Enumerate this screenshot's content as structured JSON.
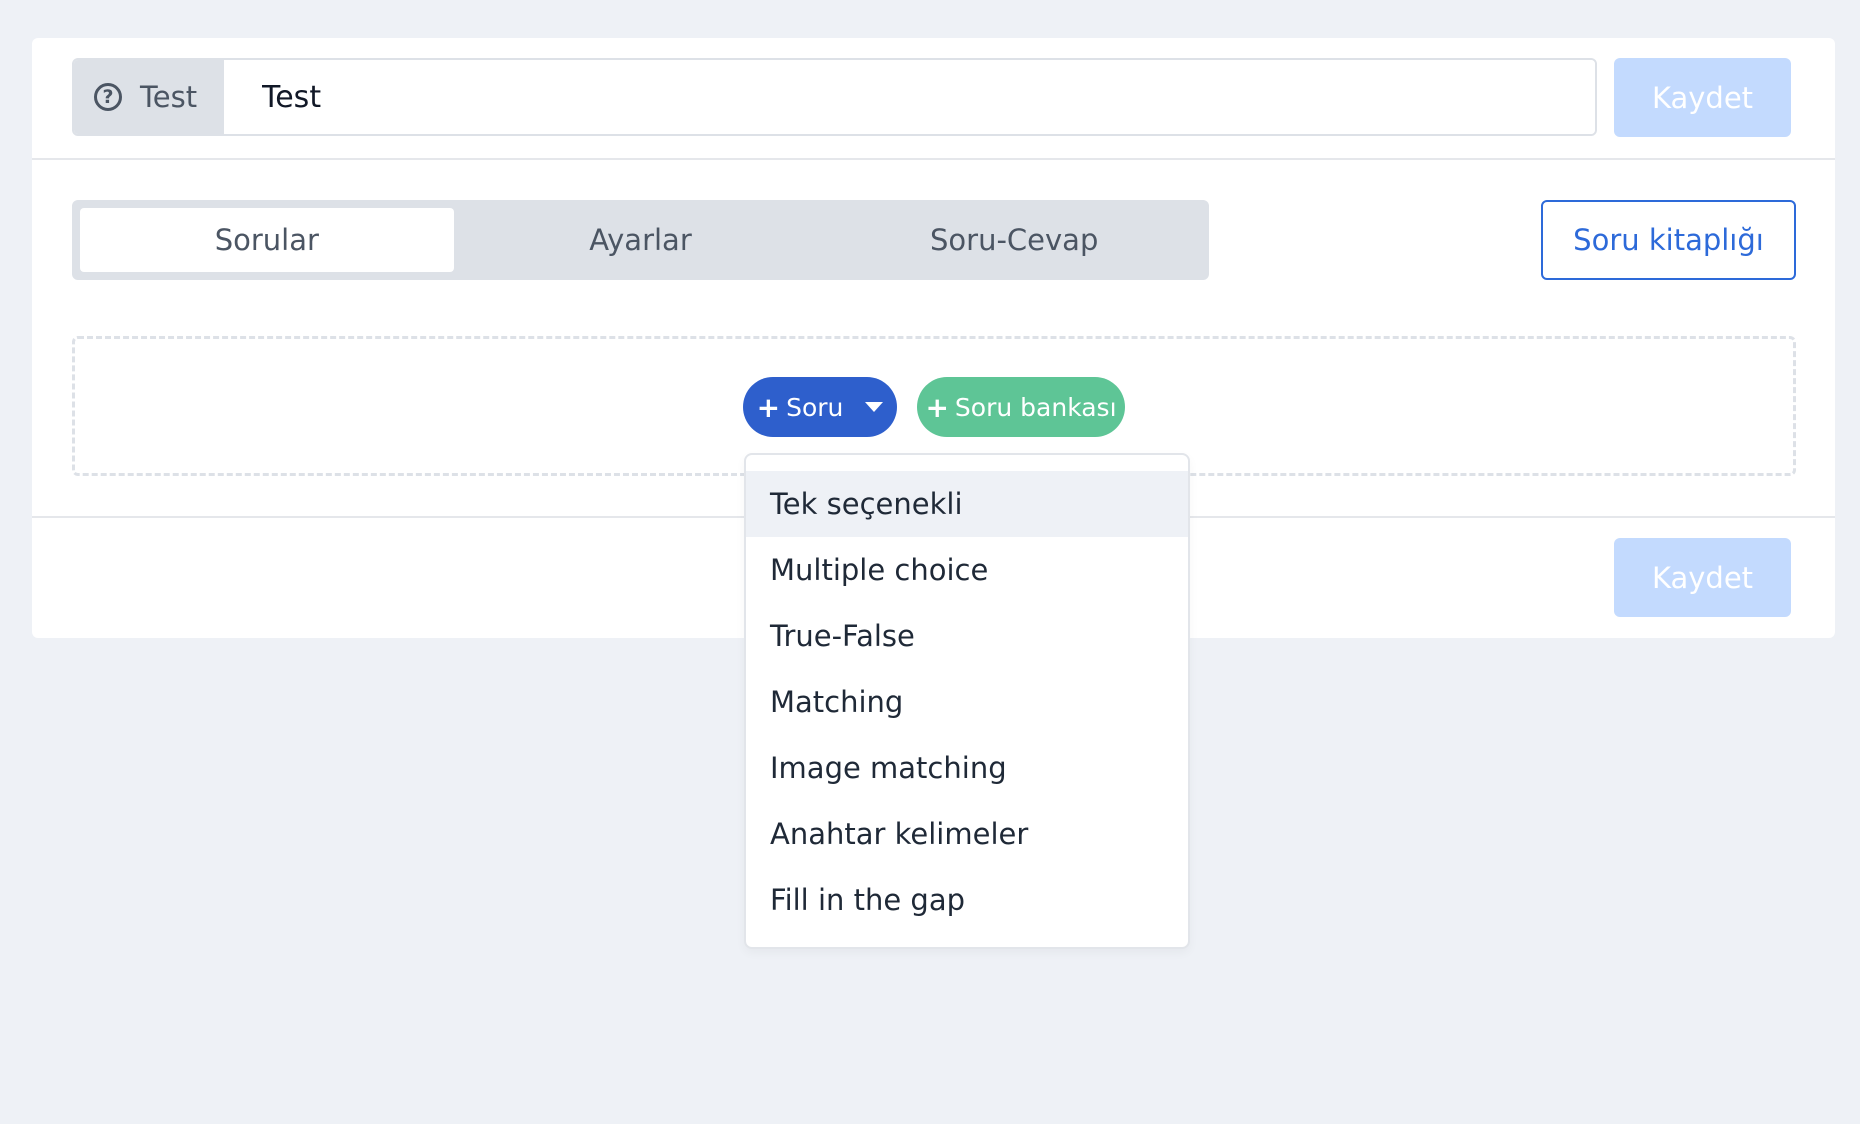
{
  "header": {
    "prefix_label": "Test",
    "title_value": "Test",
    "save_label": "Kaydet"
  },
  "tabs": [
    {
      "label": "Sorular",
      "active": true
    },
    {
      "label": "Ayarlar",
      "active": false
    },
    {
      "label": "Soru-Cevap",
      "active": false
    }
  ],
  "library_button": "Soru kitaplığı",
  "actions": {
    "add_question_label": "Soru",
    "question_bank_label": "Soru bankası"
  },
  "question_type_menu": {
    "items": [
      "Tek seçenekli",
      "Multiple choice",
      "True-False",
      "Matching",
      "Image matching",
      "Anahtar kelimeler",
      "Fill in the gap"
    ],
    "highlighted_index": 0
  },
  "footer": {
    "save_label": "Kaydet"
  },
  "colors": {
    "primary": "#2e5fcc",
    "success": "#5ec596",
    "save_disabled": "#c3dafe",
    "library_border": "#2d6ad9",
    "background": "#eef1f6"
  },
  "icons": {
    "prefix": "question-circle-icon",
    "add": "plus-icon",
    "dropdown": "caret-down-icon"
  }
}
